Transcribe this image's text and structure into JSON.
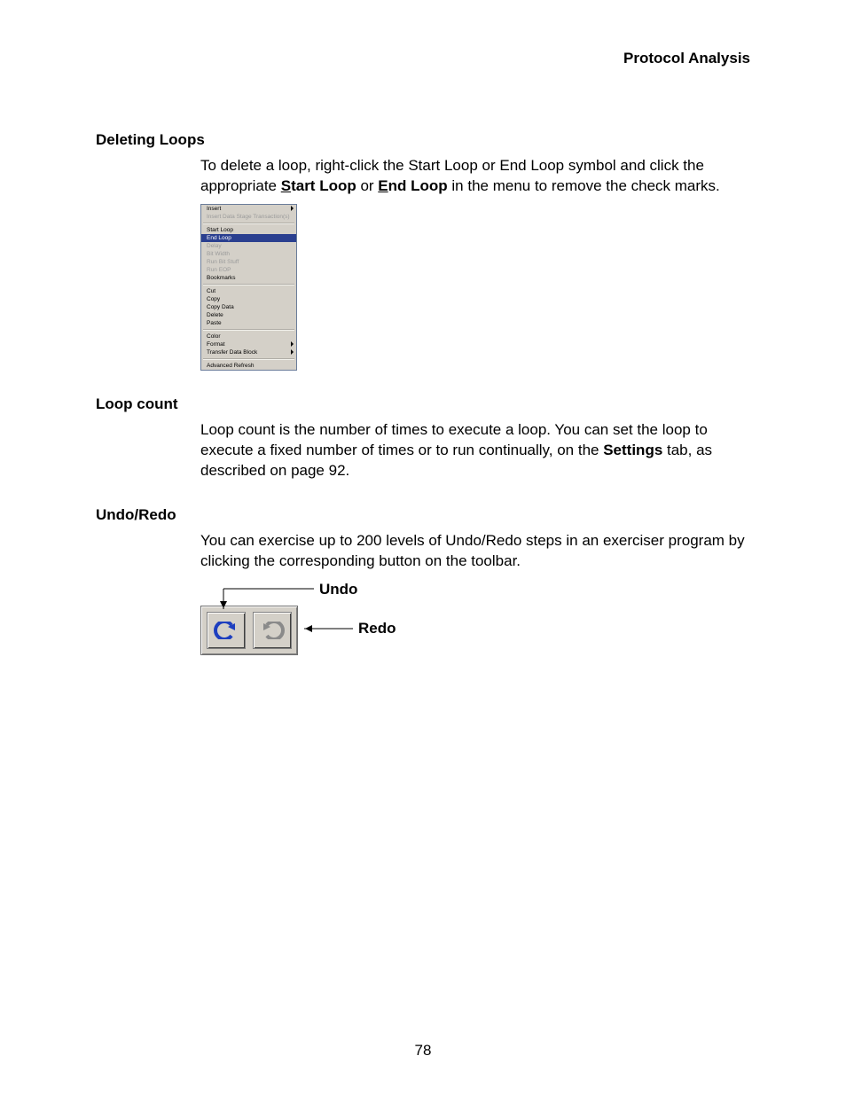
{
  "header": {
    "title": "Protocol Analysis"
  },
  "page_number": "78",
  "sections": {
    "deleting_loops": {
      "heading": "Deleting Loops",
      "para_prefix": "To delete a loop, right-click the Start Loop or End Loop symbol and click the appropriate ",
      "start_s": "S",
      "start_rest": "tart Loop",
      "para_mid": " or ",
      "end_e": "E",
      "end_rest": "nd Loop",
      "para_suffix": " in the menu to remove the check marks."
    },
    "loop_count": {
      "heading": "Loop count",
      "para_pre": "Loop count is the number of times to execute a loop. You can set the loop to execute a fixed number of times or to run continually, on the ",
      "settings": "Settings",
      "para_post": " tab, as described on page 92."
    },
    "undo_redo": {
      "heading": "Undo/Redo",
      "para": "You can exercise up to 200 levels of Undo/Redo steps in an exerciser program by clicking the corresponding button on the toolbar.",
      "undo_label": "Undo",
      "redo_label": "Redo"
    }
  },
  "context_menu": {
    "items": [
      {
        "label": "Insert",
        "disabled": false,
        "submenu": true
      },
      {
        "label": "Insert Data Stage Transaction(s)",
        "disabled": true
      },
      "sep",
      {
        "label": "Start Loop"
      },
      {
        "label": "End Loop",
        "highlight": true
      },
      {
        "label": "Delay",
        "disabled": true
      },
      {
        "label": "Bit Width",
        "disabled": true
      },
      {
        "label": "Run Bit Stuff",
        "disabled": true
      },
      {
        "label": "Run EOP",
        "disabled": true
      },
      {
        "label": "Bookmarks"
      },
      "sep",
      {
        "label": "Cut"
      },
      {
        "label": "Copy"
      },
      {
        "label": "Copy Data"
      },
      {
        "label": "Delete"
      },
      {
        "label": "Paste"
      },
      "sep",
      {
        "label": "Color"
      },
      {
        "label": "Format",
        "submenu": true
      },
      {
        "label": "Transfer Data Block",
        "submenu": true
      },
      "sep",
      {
        "label": "Advanced Refresh"
      }
    ]
  }
}
